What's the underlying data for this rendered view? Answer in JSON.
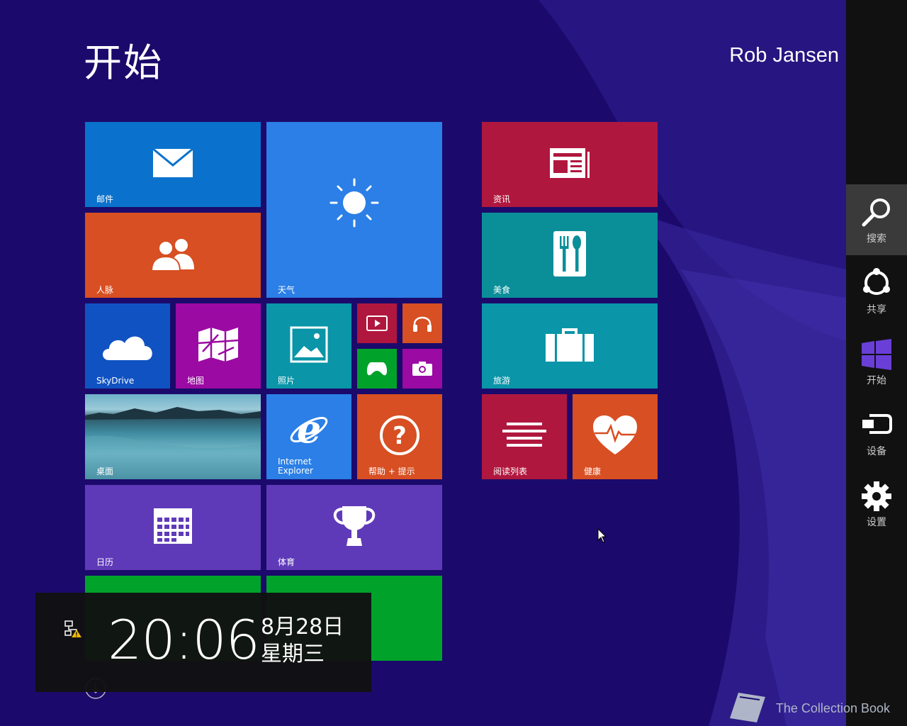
{
  "start": {
    "title": "开始",
    "user": "Rob Jansen"
  },
  "tiles": {
    "mail": "邮件",
    "weather": "天气",
    "people": "人脉",
    "skydrive": "SkyDrive",
    "maps": "地图",
    "photos": "照片",
    "desktop": "桌面",
    "ie_line1": "Internet",
    "ie_line2": "Explorer",
    "help": "帮助 + 提示",
    "calendar": "日历",
    "sports": "体育",
    "news": "资讯",
    "food": "美食",
    "travel": "旅游",
    "reading": "阅读列表",
    "health": "健康"
  },
  "colors": {
    "background": "#1b0a6b",
    "mail": "#0a72cc",
    "weather": "#2b7fe6",
    "people": "#d74f22",
    "skydrive": "#1152c2",
    "maps": "#9b0aa3",
    "photos": "#0a95a8",
    "ie": "#2b7fe6",
    "help": "#d74f22",
    "calendar": "#5f3ab8",
    "sports": "#5f3ab8",
    "news": "#b0173e",
    "food": "#0a8f99",
    "travel": "#0a95a8",
    "reading": "#b0173e",
    "health": "#d74f22",
    "green": "#00a22a",
    "charm_accent": "#6a3fd8"
  },
  "charms": [
    {
      "label": "搜索",
      "icon": "magnifier-icon"
    },
    {
      "label": "共享",
      "icon": "share-icon"
    },
    {
      "label": "开始",
      "icon": "windows-logo-icon"
    },
    {
      "label": "设备",
      "icon": "devices-icon"
    },
    {
      "label": "设置",
      "icon": "gear-icon"
    }
  ],
  "clock": {
    "time": "20:06",
    "date": "8月28日",
    "weekday": "星期三"
  },
  "watermark": "The Collection Book"
}
